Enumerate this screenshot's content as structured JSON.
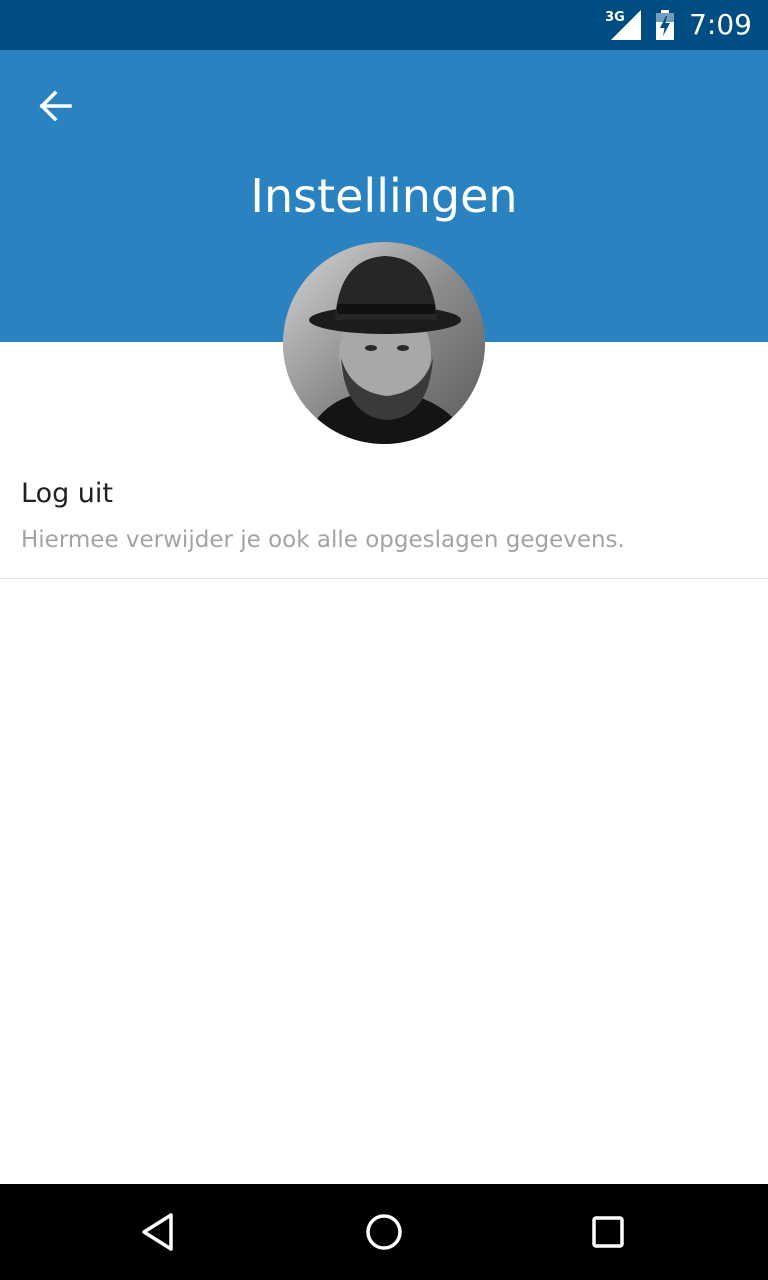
{
  "status_bar": {
    "network_label": "3G",
    "time": "7:09",
    "icons": [
      "network-signal-icon",
      "battery-charging-icon"
    ]
  },
  "app_bar": {
    "back_icon": "arrow-back-icon",
    "title": "Instellingen",
    "color": "#2a82c0"
  },
  "profile": {
    "avatar": "profile-photo"
  },
  "settings": {
    "logout": {
      "title": "Log uit",
      "subtitle": "Hiermee verwijder je ook alle opgeslagen gegevens."
    }
  },
  "nav_bar": {
    "buttons": [
      "back-triangle-icon",
      "home-circle-icon",
      "recents-square-icon"
    ]
  },
  "colors": {
    "status_bar": "#004d84",
    "app_bar": "#2a82c0",
    "subtitle_text": "#a3a3a3"
  }
}
